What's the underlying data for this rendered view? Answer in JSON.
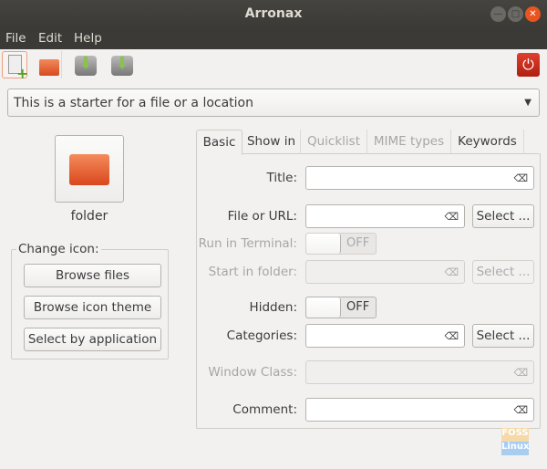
{
  "window": {
    "title": "Arronax"
  },
  "menu": [
    "File",
    "Edit",
    "Help"
  ],
  "toolbar": {
    "icons": [
      "new-file-icon",
      "open-folder-icon",
      "save-icon",
      "save-as-icon",
      "quit-power-icon"
    ]
  },
  "starter": {
    "value": "This is a starter for a file or a location"
  },
  "icon_panel": {
    "icon_label": "folder",
    "frame_title": "Change icon:",
    "buttons": [
      "Browse files",
      "Browse icon theme",
      "Select by application"
    ]
  },
  "tabs": [
    {
      "label": "Basic",
      "active": true
    },
    {
      "label": "Show in"
    },
    {
      "label": "Quicklist",
      "disabled": true
    },
    {
      "label": "MIME types",
      "disabled": true
    },
    {
      "label": "Keywords"
    }
  ],
  "form": {
    "title_label": "Title:",
    "title_value": "",
    "file_label": "File or URL:",
    "file_value": "",
    "select_label": "Select ...",
    "terminal_label": "Run in Terminal:",
    "terminal_state": "OFF",
    "folder_label": "Start in folder:",
    "hidden_label": "Hidden:",
    "hidden_state": "OFF",
    "categories_label": "Categories:",
    "wmclass_label": "Window Class:",
    "comment_label": "Comment:"
  },
  "watermark": {
    "line1": "FOSS",
    "line2": "Linux"
  },
  "colors": {
    "accent": "#e95420",
    "titlebar": "#3b3a36",
    "power": "#d1281a"
  }
}
